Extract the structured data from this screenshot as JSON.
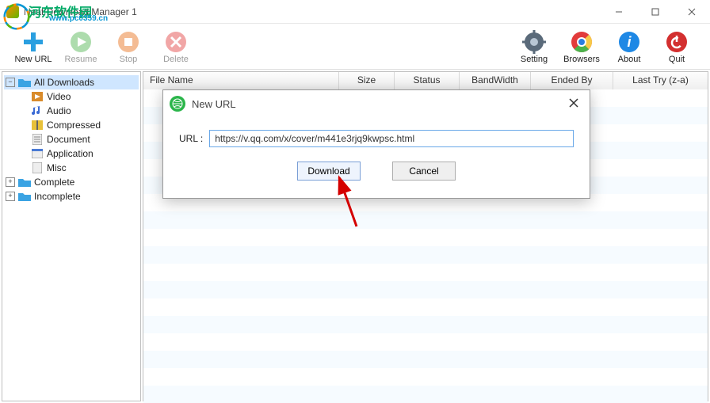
{
  "window": {
    "title": "Neat Download Manager 1"
  },
  "watermark": {
    "text": "河东软件园",
    "sub": "www.pc0359.cn"
  },
  "toolbar": {
    "new_url": "New URL",
    "resume": "Resume",
    "stop": "Stop",
    "delete": "Delete",
    "setting": "Setting",
    "browsers": "Browsers",
    "about": "About",
    "quit": "Quit"
  },
  "sidebar": {
    "all_downloads": "All Downloads",
    "children": [
      "Video",
      "Audio",
      "Compressed",
      "Document",
      "Application",
      "Misc"
    ],
    "complete": "Complete",
    "incomplete": "Incomplete"
  },
  "columns": {
    "file_name": "File Name",
    "size": "Size",
    "status": "Status",
    "bandwidth": "BandWidth",
    "ended_by": "Ended By",
    "last_try": "Last Try (z-a)"
  },
  "dialog": {
    "title": "New URL",
    "url_label": "URL :",
    "url_value": "https://v.qq.com/x/cover/m441e3rjq9kwpsc.html",
    "download": "Download",
    "cancel": "Cancel"
  }
}
